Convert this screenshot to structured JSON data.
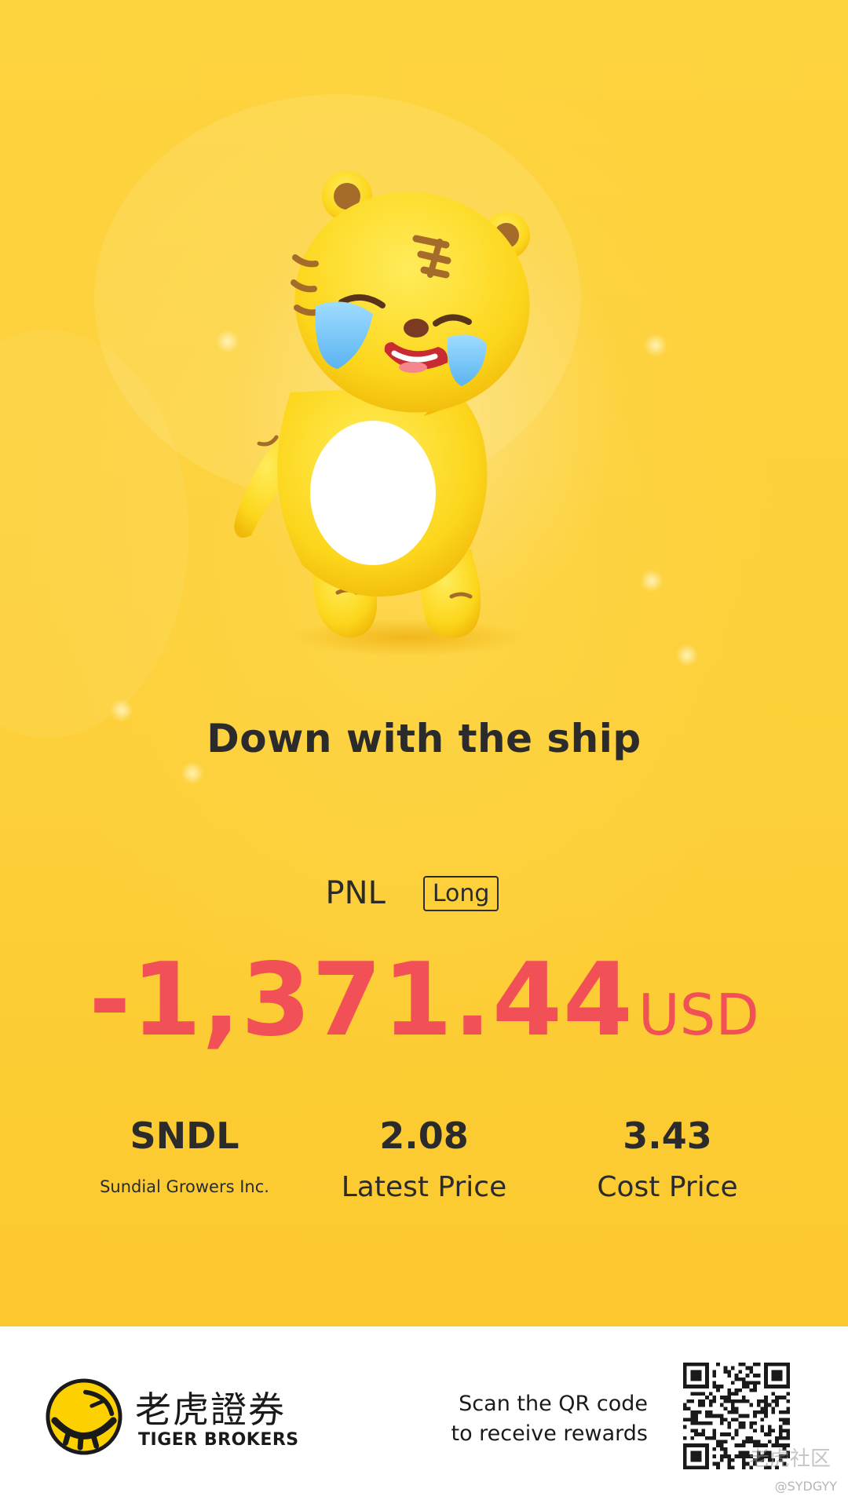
{
  "headline": "Down with the ship",
  "pnl": {
    "label": "PNL",
    "position_tag": "Long",
    "amount": "-1,371.44",
    "currency": "USD"
  },
  "stock": {
    "symbol": "SNDL",
    "company_name": "Sundial Growers Inc."
  },
  "latest_price": {
    "value": "2.08",
    "label": "Latest Price"
  },
  "cost_price": {
    "value": "3.43",
    "label": "Cost Price"
  },
  "footer": {
    "brand_cn": "老虎證券",
    "brand_en": "TIGER BROKERS",
    "scan_line1": "Scan the QR code",
    "scan_line2": "to receive rewards",
    "watermark": "老虎社区",
    "handle": "@SYDGYY"
  },
  "colors": {
    "background": "#fdd33e",
    "loss": "#f25057",
    "text": "#2b2b2b"
  },
  "icons": {
    "mascot": "crying-tiger-mascot",
    "logo": "tiger-brokers-logo-icon",
    "qr": "qr-code-icon"
  }
}
